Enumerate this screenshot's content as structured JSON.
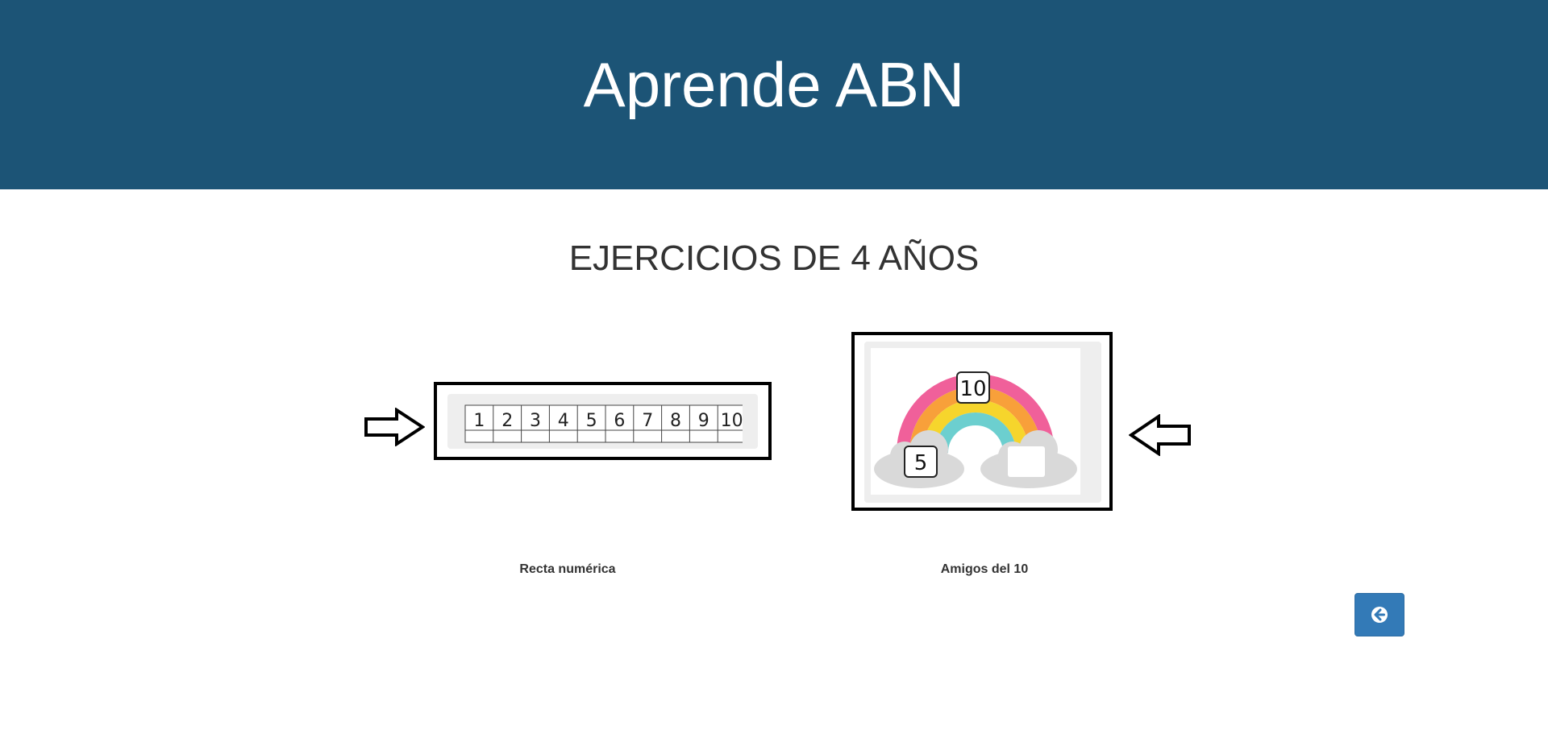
{
  "header": {
    "title": "Aprende ABN"
  },
  "main": {
    "subtitle": "EJERCICIOS DE 4 AÑOS",
    "exercises": [
      {
        "label": "Recta numérica",
        "image": {
          "numbers": [
            "1",
            "2",
            "3",
            "4",
            "5",
            "6",
            "7",
            "8",
            "9",
            "10"
          ]
        }
      },
      {
        "label": "Amigos del 10",
        "image": {
          "top_number": "10",
          "left_number": "5",
          "right_number": ""
        }
      }
    ]
  },
  "icons": {
    "pointer_left_card": "arrow-right-outline-icon",
    "pointer_right_card": "arrow-left-outline-icon",
    "back": "circle-arrow-left-icon"
  },
  "colors": {
    "header_bg": "#1c5476",
    "header_text": "#ffffff",
    "back_button": "#337ab7",
    "card_border": "#000000",
    "rainbow": [
      "#f0609a",
      "#f8a03a",
      "#f6d52c",
      "#6ccfcf"
    ]
  }
}
